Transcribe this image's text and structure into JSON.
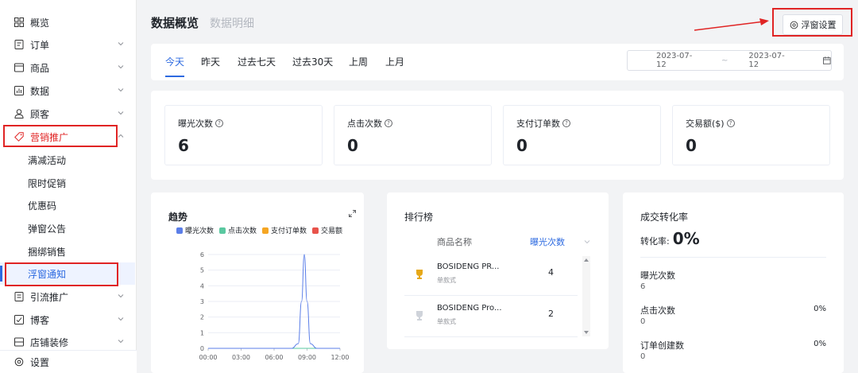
{
  "sidebar": {
    "items": [
      {
        "label": "概览",
        "icon": "grid-icon"
      },
      {
        "label": "订单",
        "icon": "order-icon"
      },
      {
        "label": "商品",
        "icon": "box-icon"
      },
      {
        "label": "数据",
        "icon": "bar-chart-icon"
      },
      {
        "label": "顾客",
        "icon": "user-icon"
      },
      {
        "label": "营销推广",
        "icon": "tag-icon"
      },
      {
        "label": "引流推广",
        "icon": "traffic-icon"
      },
      {
        "label": "博客",
        "icon": "blog-icon"
      },
      {
        "label": "店铺装修",
        "icon": "store-icon"
      },
      {
        "label": "设置",
        "icon": "gear-icon"
      }
    ],
    "subitems": [
      "满减活动",
      "限时促销",
      "优惠码",
      "弹窗公告",
      "捆绑销售",
      "浮窗通知"
    ]
  },
  "header": {
    "title": "数据概览",
    "subtitle": "数据明细",
    "float_button": "浮窗设置"
  },
  "tabs": [
    "今天",
    "昨天",
    "过去七天",
    "过去30天",
    "上周",
    "上月"
  ],
  "date_range": {
    "start": "2023-07-12",
    "separator": "~",
    "end": "2023-07-12"
  },
  "stats": [
    {
      "label": "曝光次数",
      "value": "6"
    },
    {
      "label": "点击次数",
      "value": "0"
    },
    {
      "label": "支付订单数",
      "value": "0"
    },
    {
      "label": "交易额($)",
      "value": "0"
    }
  ],
  "trend": {
    "title": "趋势"
  },
  "chart_data": {
    "type": "line",
    "x": [
      "00:00",
      "03:00",
      "06:00",
      "09:00",
      "12:00"
    ],
    "ylim": [
      0,
      6
    ],
    "yticks": [
      "0",
      "1",
      "2",
      "3",
      "4",
      "5",
      "6"
    ],
    "series": [
      {
        "name": "曝光次数",
        "color": "#5b7ee8",
        "points": [
          [
            0,
            0
          ],
          [
            7.6,
            0
          ],
          [
            8.2,
            0.3
          ],
          [
            8.5,
            3
          ],
          [
            8.75,
            6
          ],
          [
            9.0,
            3
          ],
          [
            9.3,
            0.3
          ],
          [
            9.9,
            0
          ],
          [
            13,
            0
          ]
        ]
      },
      {
        "name": "点击次数",
        "color": "#5ac8a0",
        "points": [
          [
            0,
            0
          ],
          [
            13,
            0
          ]
        ]
      },
      {
        "name": "支付订单数",
        "color": "#f5a623",
        "points": [
          [
            0,
            0
          ],
          [
            13,
            0
          ]
        ]
      },
      {
        "name": "交易额",
        "color": "#e8534b",
        "points": [
          [
            0,
            0
          ],
          [
            13,
            0
          ]
        ]
      }
    ]
  },
  "ranking": {
    "title": "排行榜",
    "col_name": "商品名称",
    "col_metric": "曝光次数",
    "rows": [
      {
        "name": "BOSIDENG PR...",
        "type": "单款式",
        "value": "4"
      },
      {
        "name": "BOSIDENG Pro...",
        "type": "单款式",
        "value": "2"
      }
    ]
  },
  "conversion": {
    "title": "成交转化率",
    "rate_label": "转化率:",
    "rate_value": "0%",
    "rows": [
      {
        "label": "曝光次数",
        "value": "6",
        "pct": ""
      },
      {
        "label": "点击次数",
        "value": "0",
        "pct": "0%"
      },
      {
        "label": "订单创建数",
        "value": "0",
        "pct": "0%"
      }
    ]
  }
}
